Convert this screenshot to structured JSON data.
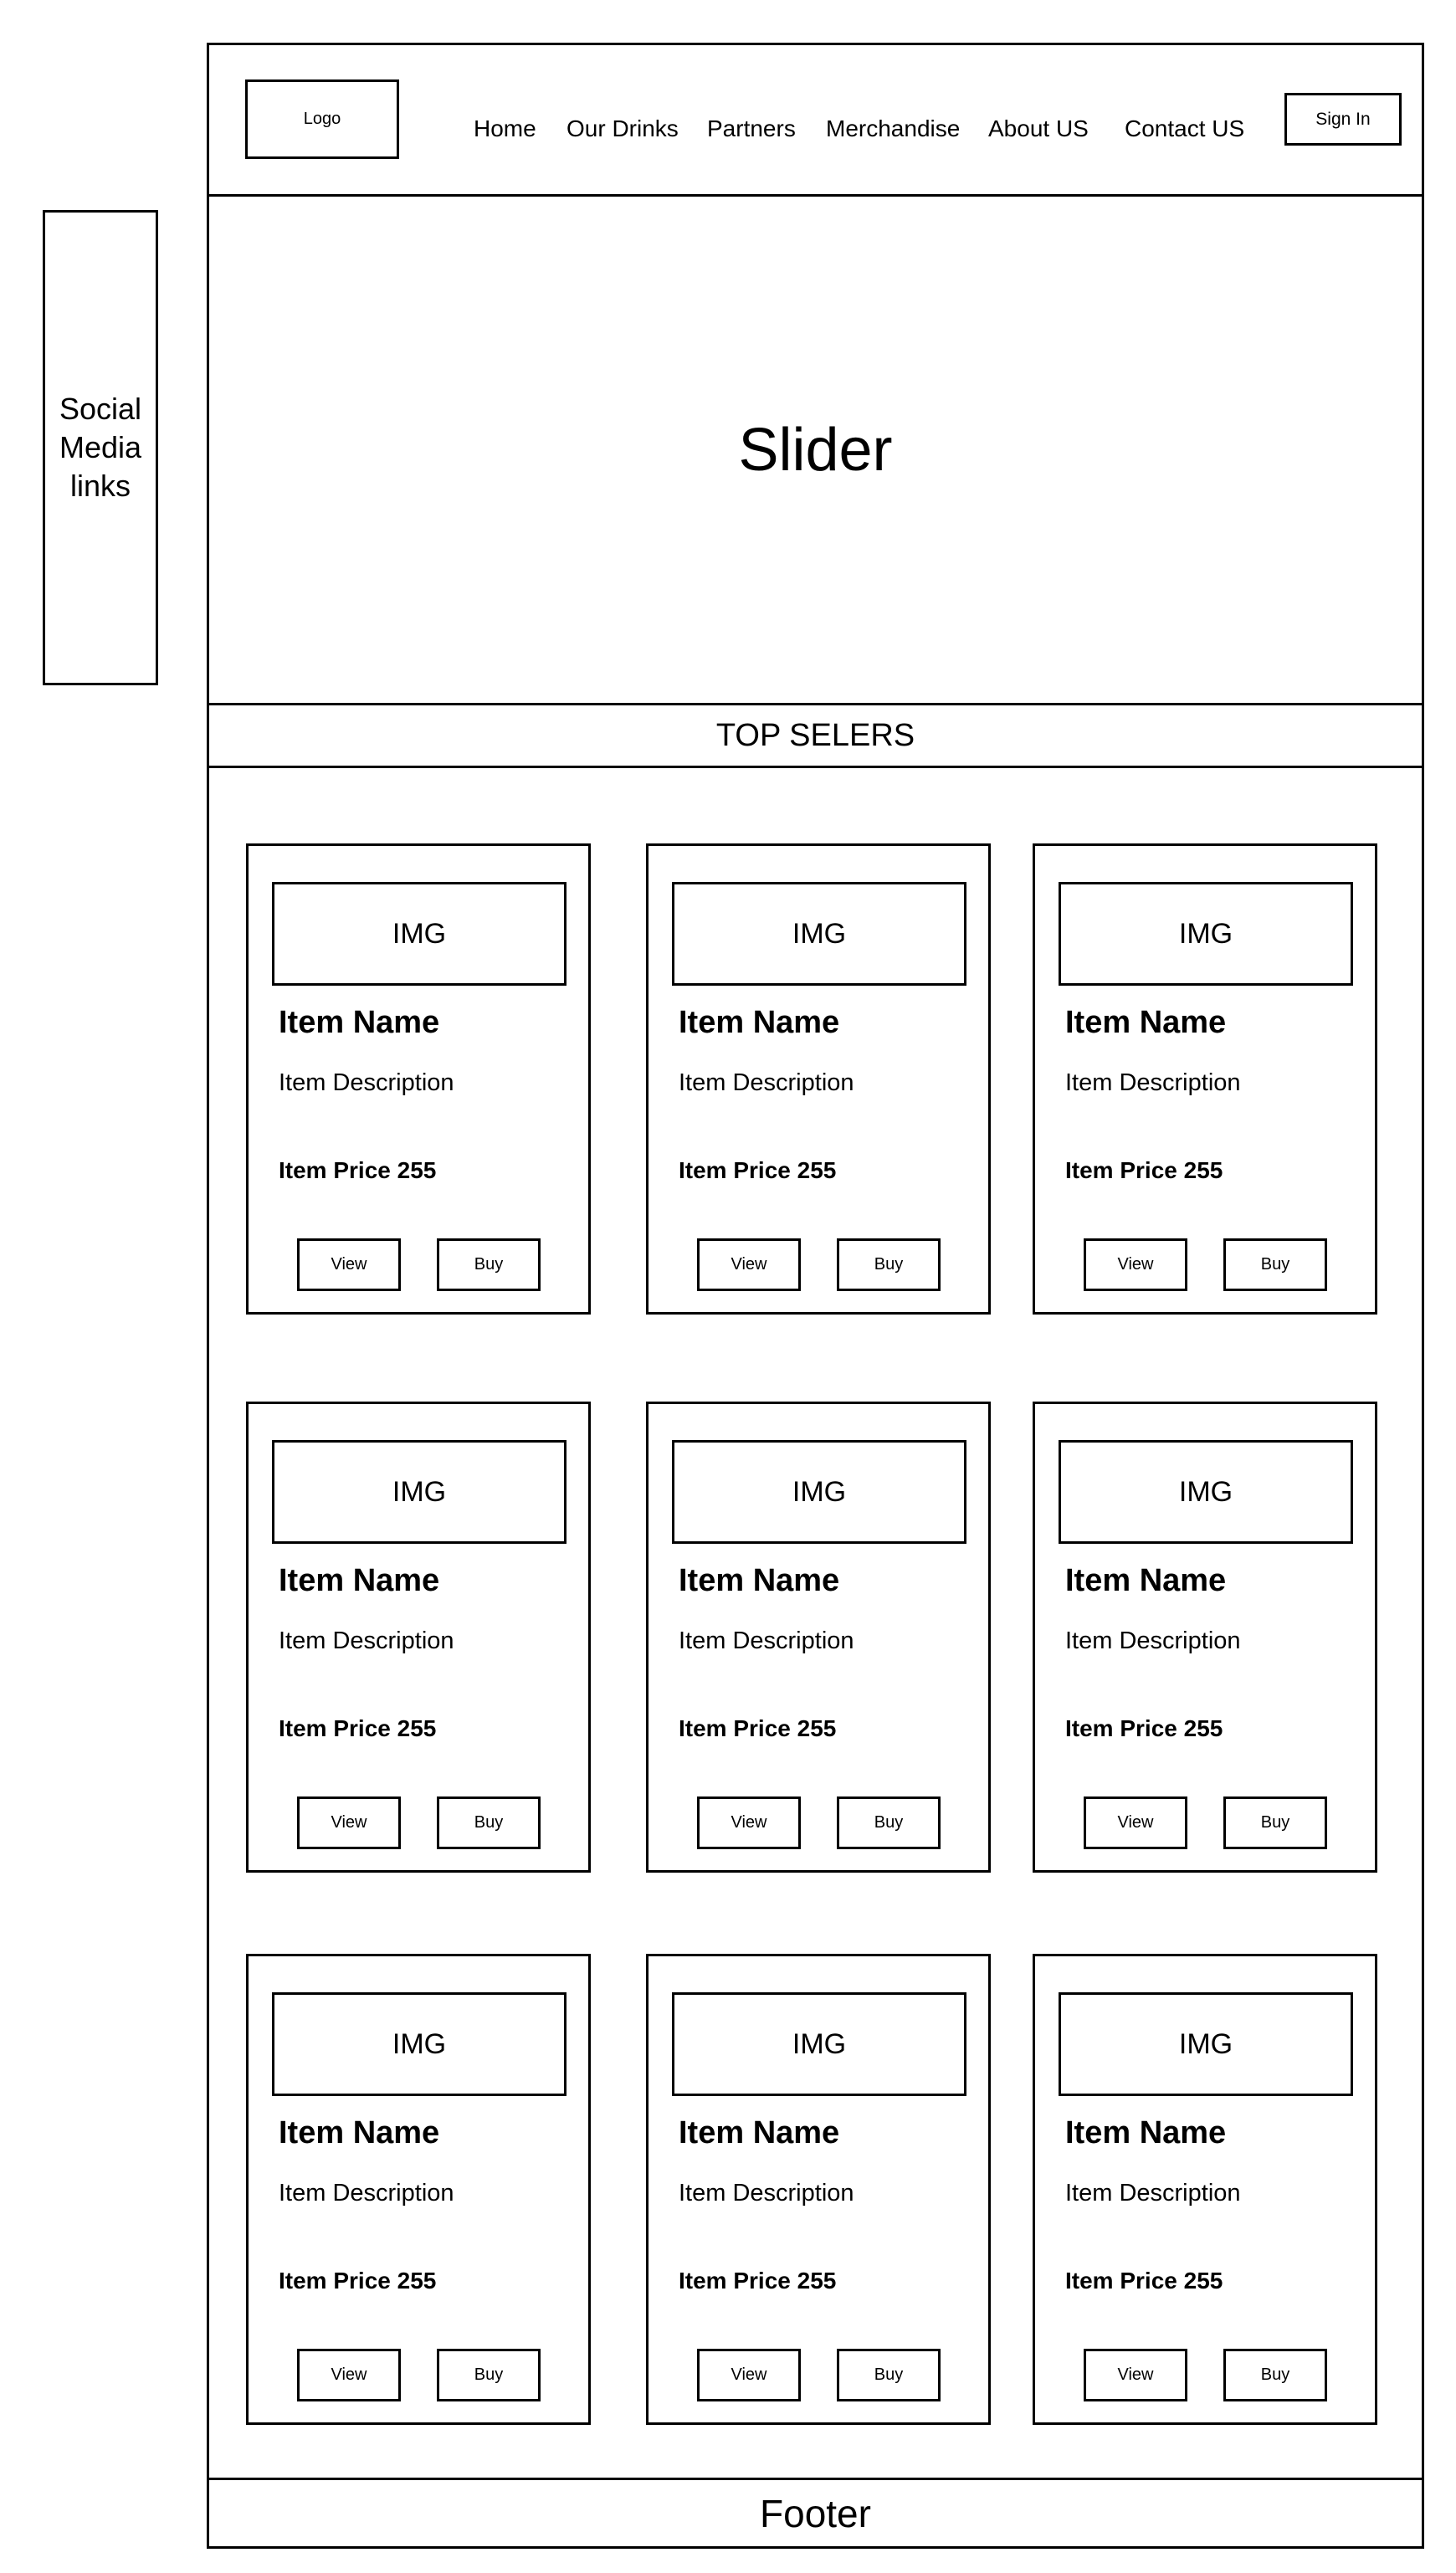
{
  "sidebar": {
    "social_label": "Social Media links"
  },
  "header": {
    "logo_label": "Logo",
    "nav": [
      "Home",
      "Our Drinks",
      "Partners",
      "Merchandise",
      "About US",
      "Contact US"
    ],
    "sign_in_label": "Sign In"
  },
  "slider": {
    "label": "Slider"
  },
  "section": {
    "title": "TOP SELERS"
  },
  "products": [
    {
      "img": "IMG",
      "name": "Item Name",
      "description": "Item Description",
      "price": "Item Price 255",
      "view_label": "View",
      "buy_label": "Buy"
    },
    {
      "img": "IMG",
      "name": "Item Name",
      "description": "Item Description",
      "price": "Item Price 255",
      "view_label": "View",
      "buy_label": "Buy"
    },
    {
      "img": "IMG",
      "name": "Item Name",
      "description": "Item Description",
      "price": "Item Price 255",
      "view_label": "View",
      "buy_label": "Buy"
    },
    {
      "img": "IMG",
      "name": "Item Name",
      "description": "Item Description",
      "price": "Item Price 255",
      "view_label": "View",
      "buy_label": "Buy"
    },
    {
      "img": "IMG",
      "name": "Item Name",
      "description": "Item Description",
      "price": "Item Price 255",
      "view_label": "View",
      "buy_label": "Buy"
    },
    {
      "img": "IMG",
      "name": "Item Name",
      "description": "Item Description",
      "price": "Item Price 255",
      "view_label": "View",
      "buy_label": "Buy"
    },
    {
      "img": "IMG",
      "name": "Item Name",
      "description": "Item Description",
      "price": "Item Price 255",
      "view_label": "View",
      "buy_label": "Buy"
    },
    {
      "img": "IMG",
      "name": "Item Name",
      "description": "Item Description",
      "price": "Item Price 255",
      "view_label": "View",
      "buy_label": "Buy"
    },
    {
      "img": "IMG",
      "name": "Item Name",
      "description": "Item Description",
      "price": "Item Price 255",
      "view_label": "View",
      "buy_label": "Buy"
    }
  ],
  "footer": {
    "label": "Footer"
  }
}
